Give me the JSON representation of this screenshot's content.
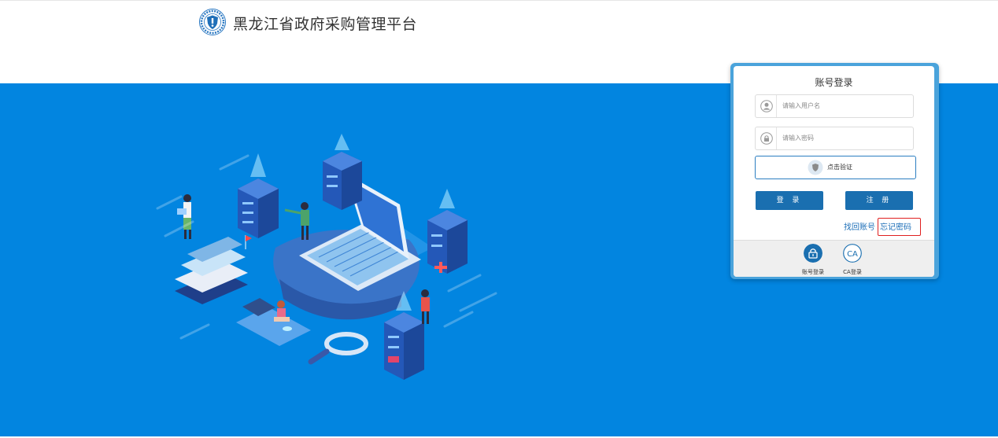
{
  "header": {
    "logo_icon": "government-shield-emblem-icon",
    "site_title": "黑龙江省政府采购管理平台"
  },
  "banner": {
    "background_color": "#0285e0",
    "illustration": "isometric-servers-laptop-illustration"
  },
  "login": {
    "title": "账号登录",
    "username_icon": "user-icon",
    "username_placeholder": "请输入用户名",
    "password_icon": "lock-icon",
    "password_placeholder": "请输入密码",
    "captcha_icon": "shield-icon",
    "captcha_label": "点击验证",
    "login_button": "登 录",
    "register_button": "注 册",
    "find_account_link": "找回账号",
    "forgot_password_link": "忘记密码",
    "button_color": "#1a6fb0",
    "highlight_color": "#e02020",
    "tabs": [
      {
        "icon": "lock-icon",
        "label": "账号登录"
      },
      {
        "icon": "ca-icon",
        "label": "CA登录"
      }
    ]
  }
}
